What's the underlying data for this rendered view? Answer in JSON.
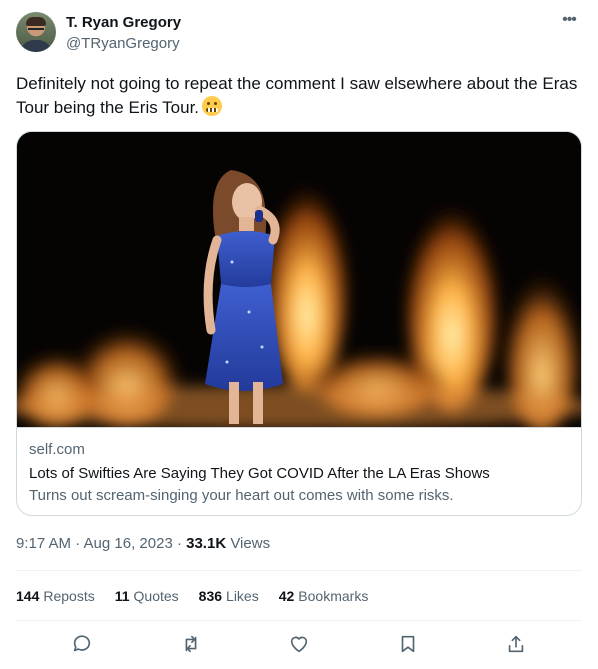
{
  "author": {
    "display_name": "T. Ryan Gregory",
    "handle": "@TRyanGregory",
    "more_icon": "more-horizontal-icon"
  },
  "tweet": {
    "text": "Definitely not going to repeat the comment I saw elsewhere about the Eras Tour being the Eris Tour.",
    "emoji": "grimacing-face-emoji"
  },
  "link_card": {
    "domain": "self.com",
    "title": "Lots of Swifties Are Saying They Got COVID After the LA Eras Shows",
    "description": "Turns out scream-singing your heart out comes with some risks."
  },
  "meta": {
    "timestamp": "9:17 AM · Aug 16, 2023 · ",
    "views_count": "33.1K",
    "views_label": " Views"
  },
  "stats": {
    "reposts_count": "144",
    "reposts_label": "Reposts",
    "quotes_count": "11",
    "quotes_label": "Quotes",
    "likes_count": "836",
    "likes_label": "Likes",
    "bookmarks_count": "42",
    "bookmarks_label": "Bookmarks"
  },
  "actions": [
    "reply-icon",
    "repost-icon",
    "like-icon",
    "bookmark-icon",
    "share-icon"
  ],
  "colors": {
    "text_primary": "#0f1419",
    "text_secondary": "#536471",
    "border": "#cfd9de",
    "divider": "#eff3f4"
  }
}
